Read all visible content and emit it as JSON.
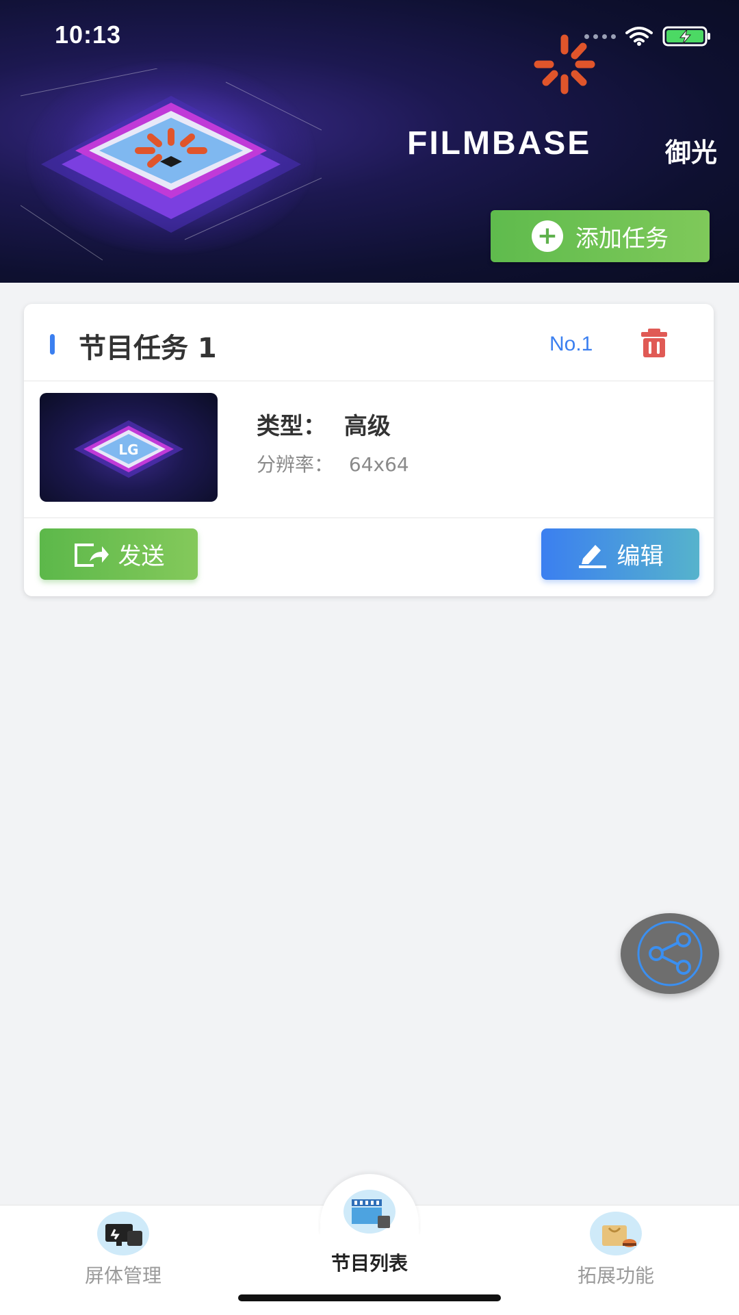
{
  "status_bar": {
    "time": "10:13"
  },
  "header": {
    "brand_name": "FILMBASE",
    "brand_cn": "御光",
    "add_task_label": "添加任务"
  },
  "task_card": {
    "title": "节目任务 1",
    "number": "No.1",
    "type_label": "类型：",
    "type_value": "高级",
    "resolution_label": "分辨率：",
    "resolution_value": "64x64",
    "send_label": "发送",
    "edit_label": "编辑"
  },
  "tabs": [
    {
      "label": "屏体管理",
      "icon": "screen-monitor-icon",
      "active": false
    },
    {
      "label": "节目列表",
      "icon": "film-clapper-icon",
      "active": true
    },
    {
      "label": "拓展功能",
      "icon": "shopping-bag-icon",
      "active": false
    }
  ],
  "colors": {
    "accent_blue": "#3b7ff0",
    "accent_green": "#5fb14d",
    "delete_red": "#e05a55",
    "brand_orange": "#e0552b"
  }
}
